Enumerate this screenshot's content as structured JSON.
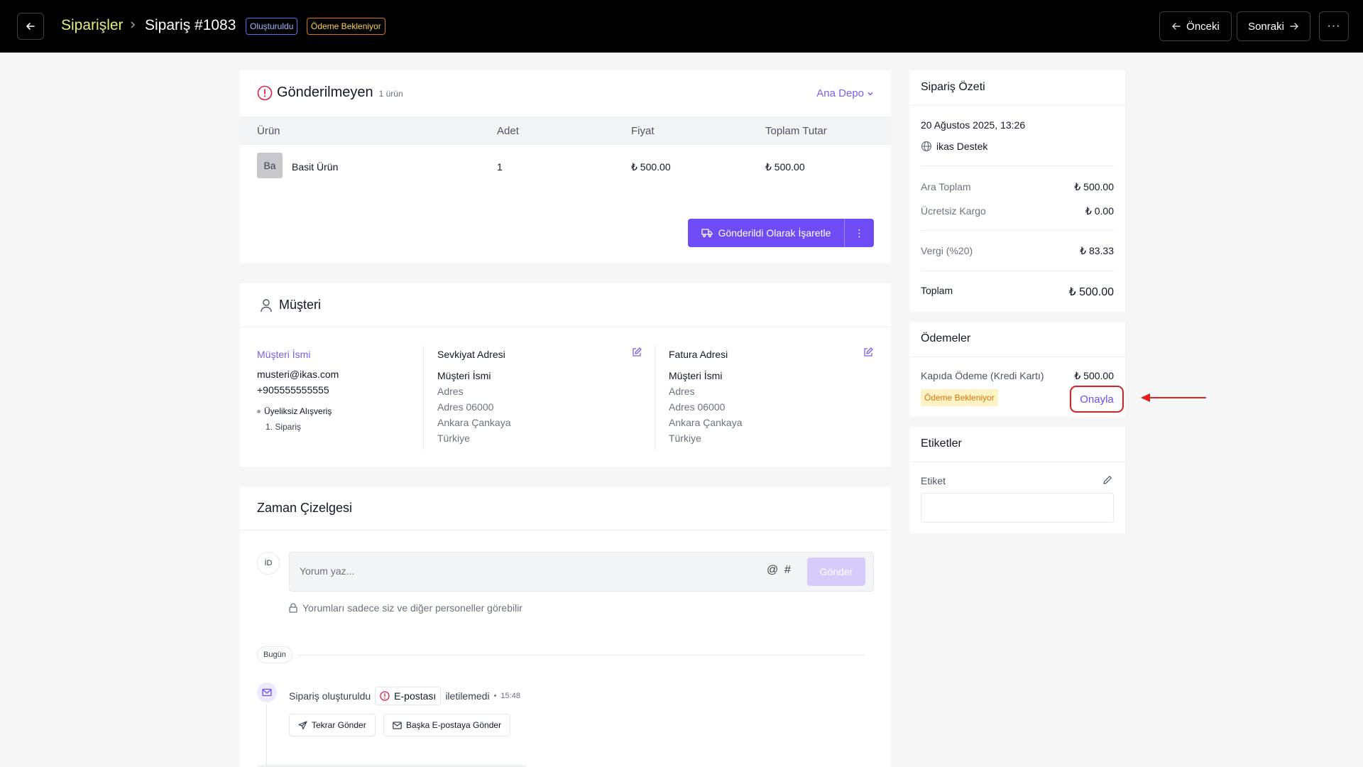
{
  "header": {
    "breadcrumb_root": "Siparişler",
    "title": "Sipariş #1083",
    "badge_created": "Oluşturuldu",
    "badge_payment": "Ödeme Bekleniyor",
    "prev_label": "Önceki",
    "next_label": "Sonraki",
    "more_label": "···"
  },
  "unshipped": {
    "title": "Gönderilmeyen",
    "count": "1 ürün",
    "warehouse": "Ana Depo",
    "columns": [
      "Ürün",
      "Adet",
      "Fiyat",
      "Toplam Tutar"
    ],
    "rows": [
      {
        "thumb": "Ba",
        "name": "Basit Ürün",
        "qty": "1",
        "price": "₺ 500.00",
        "total": "₺ 500.00"
      }
    ],
    "mark_shipped_label": "Gönderildi Olarak İşaretle",
    "more_label": "⋮"
  },
  "customer": {
    "title": "Müşteri",
    "name_link": "Müşteri İsmi",
    "email": "musteri@ikas.com",
    "phone": "+905555555555",
    "guest": "Üyeliksiz Alışveriş",
    "order_count": "1. Sipariş",
    "shipping": {
      "title": "Sevkiyat Adresi",
      "name": "Müşteri İsmi",
      "lines": [
        "Adres",
        "Adres 06000",
        "Ankara Çankaya",
        "Türkiye"
      ]
    },
    "billing": {
      "title": "Fatura Adresi",
      "name": "Müşteri İsmi",
      "lines": [
        "Adres",
        "Adres 06000",
        "Ankara Çankaya",
        "Türkiye"
      ]
    }
  },
  "timeline": {
    "title": "Zaman Çizelgesi",
    "avatar": "İD",
    "placeholder": "Yorum yaz...",
    "at": "@",
    "hash": "#",
    "send_label": "Gönder",
    "privacy": "Yorumları sadece siz ve diğer personeller görebilir",
    "today": "Bugün",
    "event": {
      "text": "Sipariş oluşturuldu",
      "chip": "E-postası",
      "status": "iletilemedi",
      "dot": "•",
      "time": "15:48",
      "resend": "Tekrar Gönder",
      "other_email": "Başka E-postaya Gönder"
    }
  },
  "summary": {
    "title": "Sipariş Özeti",
    "date": "20 Ağustos 2025, 13:26",
    "source": "ikas Destek",
    "subtotal_label": "Ara Toplam",
    "subtotal": "₺ 500.00",
    "shipping_label": "Ücretsiz Kargo",
    "shipping": "₺ 0.00",
    "tax_label": "Vergi (%20)",
    "tax": "₺ 83.33",
    "total_label": "Toplam",
    "total": "₺ 500.00"
  },
  "payments": {
    "title": "Ödemeler",
    "method": "Kapıda Ödeme (Kredi Kartı)",
    "amount": "₺ 500.00",
    "status": "Ödeme Bekleniyor",
    "approve_label": "Onayla"
  },
  "tags": {
    "title": "Etiketler",
    "label": "Etiket"
  },
  "colors": {
    "accent": "#6d4cf5",
    "highlight": "#e11d1d",
    "topbar": "#000000",
    "breadcrumb": "#e6ee80"
  }
}
